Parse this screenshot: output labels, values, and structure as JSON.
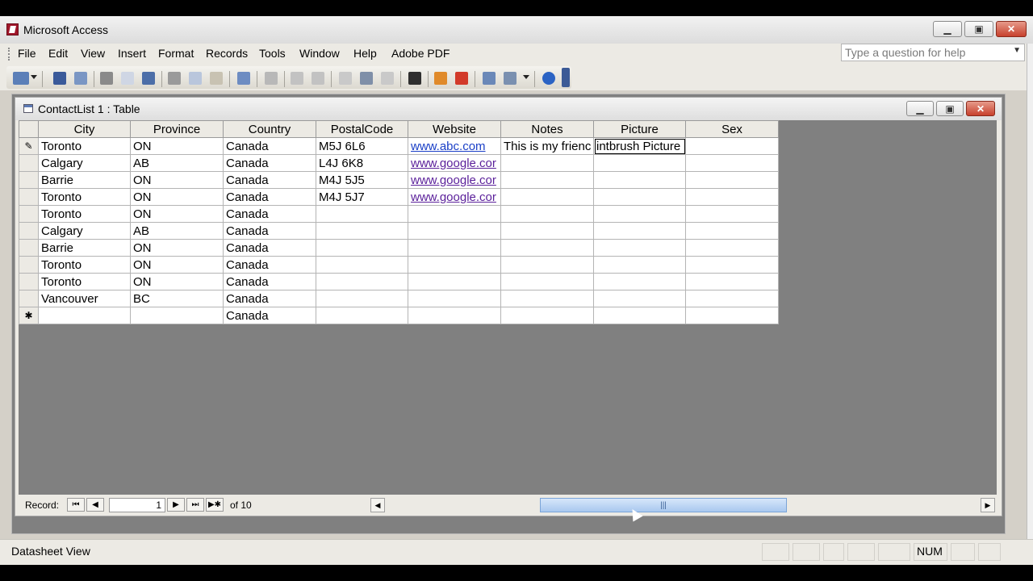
{
  "app": {
    "title": "Microsoft Access"
  },
  "menu": [
    "File",
    "Edit",
    "View",
    "Insert",
    "Format",
    "Records",
    "Tools",
    "Window",
    "Help",
    "Adobe PDF"
  ],
  "help_box": {
    "placeholder": "Type a question for help"
  },
  "table_window": {
    "title": "ContactList 1 : Table",
    "columns": [
      "City",
      "Province",
      "Country",
      "PostalCode",
      "Website",
      "Notes",
      "Picture",
      "Sex"
    ],
    "rows": [
      {
        "selector": "✎",
        "city": "Toronto",
        "province": "ON",
        "country": "Canada",
        "postal": "M5J 6L6",
        "website": "www.abc.com",
        "notes": "This is my frienc",
        "picture": "intbrush Picture",
        "sex": ""
      },
      {
        "selector": "",
        "city": "Calgary",
        "province": "AB",
        "country": "Canada",
        "postal": "L4J 6K8",
        "website": "www.google.cor",
        "notes": "",
        "picture": "",
        "sex": ""
      },
      {
        "selector": "",
        "city": "Barrie",
        "province": "ON",
        "country": "Canada",
        "postal": "M4J 5J5",
        "website": "www.google.cor",
        "notes": "",
        "picture": "",
        "sex": ""
      },
      {
        "selector": "",
        "city": "Toronto",
        "province": "ON",
        "country": "Canada",
        "postal": "M4J 5J7",
        "website": "www.google.cor",
        "notes": "",
        "picture": "",
        "sex": ""
      },
      {
        "selector": "",
        "city": "Toronto",
        "province": "ON",
        "country": "Canada",
        "postal": "",
        "website": "",
        "notes": "",
        "picture": "",
        "sex": ""
      },
      {
        "selector": "",
        "city": "Calgary",
        "province": "AB",
        "country": "Canada",
        "postal": "",
        "website": "",
        "notes": "",
        "picture": "",
        "sex": ""
      },
      {
        "selector": "",
        "city": "Barrie",
        "province": "ON",
        "country": "Canada",
        "postal": "",
        "website": "",
        "notes": "",
        "picture": "",
        "sex": ""
      },
      {
        "selector": "",
        "city": "Toronto",
        "province": "ON",
        "country": "Canada",
        "postal": "",
        "website": "",
        "notes": "",
        "picture": "",
        "sex": ""
      },
      {
        "selector": "",
        "city": "Toronto",
        "province": "ON",
        "country": "Canada",
        "postal": "",
        "website": "",
        "notes": "",
        "picture": "",
        "sex": ""
      },
      {
        "selector": "",
        "city": "Vancouver",
        "province": "BC",
        "country": "Canada",
        "postal": "",
        "website": "",
        "notes": "",
        "picture": "",
        "sex": ""
      },
      {
        "selector": "✱",
        "city": "",
        "province": "",
        "country": "Canada",
        "postal": "",
        "website": "",
        "notes": "",
        "picture": "",
        "sex": ""
      }
    ],
    "navigation": {
      "label": "Record:",
      "current": "1",
      "of_text": "of 10"
    }
  },
  "status": {
    "view": "Datasheet View",
    "num": "NUM"
  },
  "colors": {
    "link_visited": "#5a1f9a",
    "link": "#1a3fc7",
    "mdi_bg": "#808080"
  }
}
